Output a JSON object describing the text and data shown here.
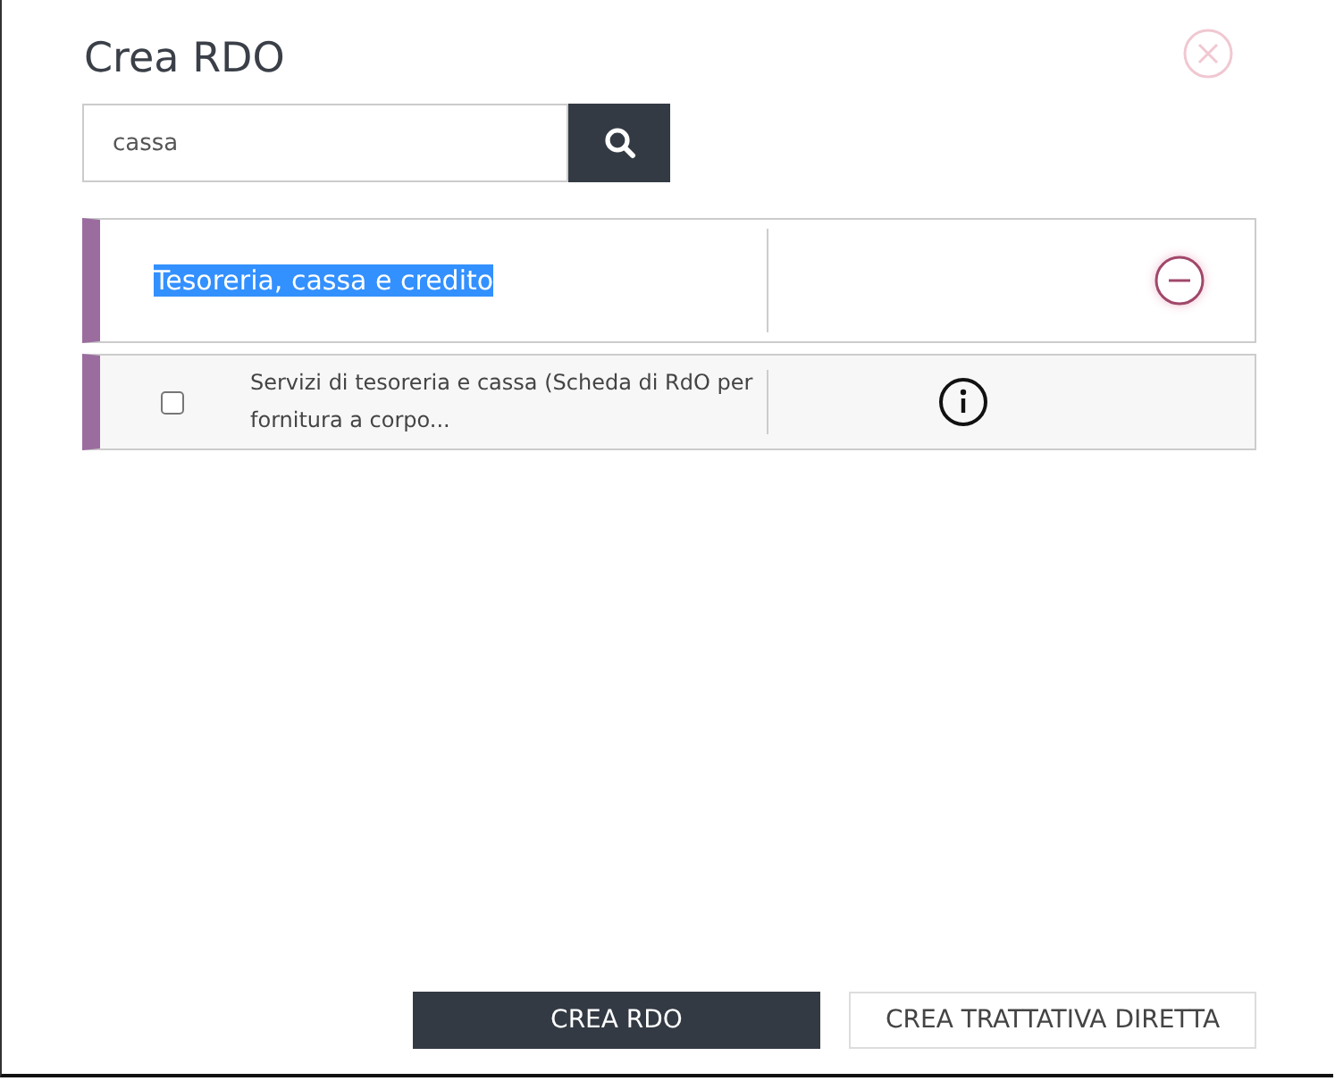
{
  "dialog": {
    "title": "Crea RDO"
  },
  "search": {
    "value": "cassa"
  },
  "category": {
    "label": "Tesoreria, cassa e credito",
    "highlighted": true,
    "expanded": true
  },
  "items": [
    {
      "label": "Servizi di tesoreria e cassa (Scheda di RdO per fornitura a corpo...",
      "checked": false
    }
  ],
  "buttons": [
    {
      "label": "CREA RDO",
      "kind": "primary"
    },
    {
      "label": "CREA TRATTATIVA DIRETTA",
      "kind": "secondary"
    }
  ]
}
